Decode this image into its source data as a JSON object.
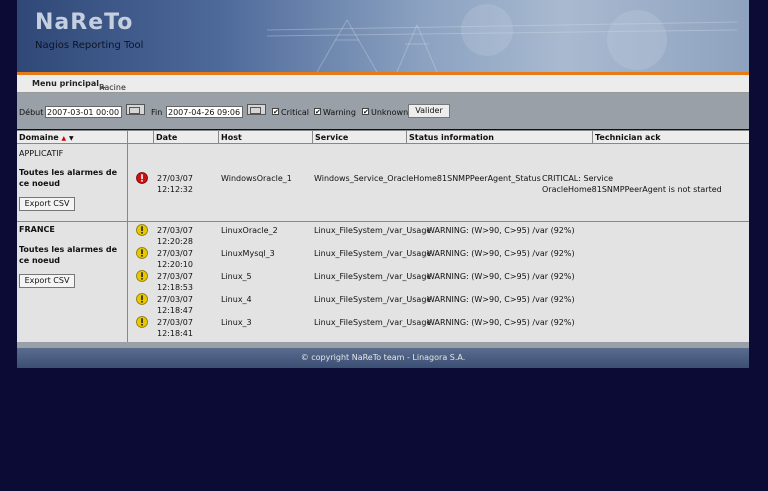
{
  "header": {
    "logo_title": "NaReTo",
    "logo_subtitle": "Nagios Reporting Tool"
  },
  "breadcrumb": {
    "root": "Menu principal",
    "separator": ">",
    "current": "Racine"
  },
  "filter": {
    "start_label": "Début",
    "start_value": "2007-03-01 00:00",
    "end_label": "Fin",
    "end_value": "2007-04-26 09:06",
    "critical_label": "Critical",
    "warning_label": "Warning",
    "unknown_label": "Unknown",
    "critical_checked": true,
    "warning_checked": true,
    "unknown_checked": true,
    "submit_label": "Valider"
  },
  "table": {
    "columns": {
      "domain": "Domaine",
      "sort_up": "▲",
      "sort_down": "▼",
      "date": "Date",
      "host": "Host",
      "service": "Service",
      "status": "Status information",
      "ack": "Technician ack"
    },
    "groups": [
      {
        "name": "APPLICATIF",
        "subtitle": "Toutes les alarmes de ce noeud",
        "export_label": "Export CSV",
        "rows": [
          {
            "level": "critical",
            "icon": "critical-icon",
            "date": "27/03/07",
            "time": "12:12:32",
            "host": "WindowsOracle_1",
            "service": "Windows_Service_OracleHome81SNMPPeerAgent_Status",
            "status_line1": "CRITICAL: Service",
            "status_line2": "OracleHome81SNMPPeerAgent is not started"
          }
        ]
      },
      {
        "name": "FRANCE",
        "subtitle": "Toutes les alarmes de ce noeud",
        "export_label": "Export CSV",
        "rows": [
          {
            "level": "warning",
            "icon": "warning-icon",
            "date": "27/03/07",
            "time": "12:20:28",
            "host": "LinuxOracle_2",
            "service": "Linux_FileSystem_/var_Usage",
            "status": "WARNING: (W>90, C>95) /var (92%)"
          },
          {
            "level": "warning",
            "icon": "warning-icon",
            "date": "27/03/07",
            "time": "12:20:10",
            "host": "LinuxMysql_3",
            "service": "Linux_FileSystem_/var_Usage",
            "status": "WARNING: (W>90, C>95) /var (92%)"
          },
          {
            "level": "warning",
            "icon": "warning-icon",
            "date": "27/03/07",
            "time": "12:18:53",
            "host": "Linux_5",
            "service": "Linux_FileSystem_/var_Usage",
            "status": "WARNING: (W>90, C>95) /var (92%)"
          },
          {
            "level": "warning",
            "icon": "warning-icon",
            "date": "27/03/07",
            "time": "12:18:47",
            "host": "Linux_4",
            "service": "Linux_FileSystem_/var_Usage",
            "status": "WARNING: (W>90, C>95) /var (92%)"
          },
          {
            "level": "warning",
            "icon": "warning-icon",
            "date": "27/03/07",
            "time": "12:18:41",
            "host": "Linux_3",
            "service": "Linux_FileSystem_/var_Usage",
            "status": "WARNING: (W>90, C>95) /var (92%)"
          }
        ]
      }
    ]
  },
  "footer": {
    "copyright": "© copyright NaReTo team - Linagora S.A."
  },
  "colors": {
    "accent_orange": "#e57b18",
    "critical_red": "#cc1111",
    "warning_yellow": "#e8c800",
    "page_background": "#0b0b36"
  }
}
